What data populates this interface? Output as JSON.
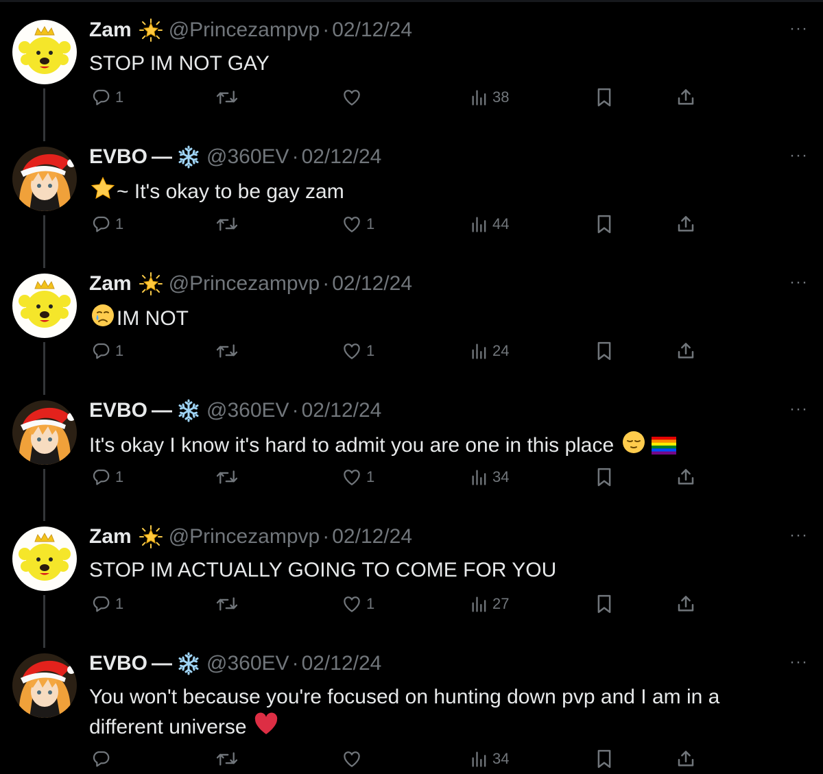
{
  "tweets": [
    {
      "name": "Zam",
      "handle": "@Princezampvp",
      "sep": "·",
      "date": "02/12/24",
      "text": "STOP IM NOT GAY",
      "replies": "1",
      "retweets": "",
      "likes": "",
      "views": "38",
      "more": "···",
      "avatar": "zam-avatar",
      "badge": "star-badge-icon"
    },
    {
      "name": "EVBO",
      "dash": "—",
      "handle": "@360EV",
      "sep": "·",
      "date": "02/12/24",
      "text": "~ It's okay to be gay zam",
      "replies": "1",
      "retweets": "",
      "likes": "1",
      "views": "44",
      "more": "···",
      "avatar": "evbo-avatar",
      "badge": "snowflake-icon"
    },
    {
      "name": "Zam",
      "handle": "@Princezampvp",
      "sep": "·",
      "date": "02/12/24",
      "text": "IM NOT",
      "replies": "1",
      "retweets": "",
      "likes": "1",
      "views": "24",
      "more": "···",
      "avatar": "zam-avatar",
      "badge": "star-badge-icon"
    },
    {
      "name": "EVBO",
      "dash": "—",
      "handle": "@360EV",
      "sep": "·",
      "date": "02/12/24",
      "text": "It's okay I know it's hard to admit you are one in this place",
      "replies": "1",
      "retweets": "",
      "likes": "1",
      "views": "34",
      "more": "···",
      "avatar": "evbo-avatar",
      "badge": "snowflake-icon"
    },
    {
      "name": "Zam",
      "handle": "@Princezampvp",
      "sep": "·",
      "date": "02/12/24",
      "text": "STOP IM ACTUALLY GOING TO COME FOR YOU",
      "replies": "1",
      "retweets": "",
      "likes": "1",
      "views": "27",
      "more": "···",
      "avatar": "zam-avatar",
      "badge": "star-badge-icon"
    },
    {
      "name": "EVBO",
      "dash": "—",
      "handle": "@360EV",
      "sep": "·",
      "date": "02/12/24",
      "text": "You won't because you're focused on hunting down pvp and I am in a different universe",
      "replies": "",
      "retweets": "",
      "likes": "",
      "views": "34",
      "more": "···",
      "avatar": "evbo-avatar",
      "badge": "snowflake-icon"
    }
  ],
  "colors": {
    "background": "#000000",
    "text": "#e7e9ea",
    "muted": "#71767b",
    "connector": "#333639"
  }
}
